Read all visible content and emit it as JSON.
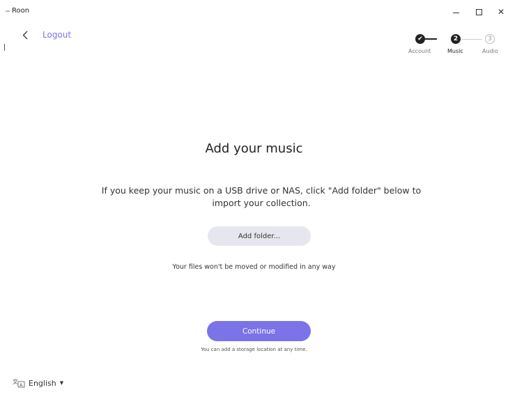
{
  "window": {
    "title": "Roon",
    "minimize_glyph": "–",
    "maximize_glyph": "☐",
    "close_glyph": "✕"
  },
  "nav": {
    "back_icon": "chevron-left-icon",
    "logout_label": "Logout"
  },
  "stepper": {
    "steps": [
      {
        "label": "Account",
        "marker": "✔",
        "state": "done"
      },
      {
        "label": "Music",
        "marker": "2",
        "state": "current"
      },
      {
        "label": "Audio",
        "marker": "3",
        "state": "upcoming"
      }
    ]
  },
  "main": {
    "heading": "Add your music",
    "description": "If you keep your music on a USB drive or NAS, click \"Add folder\" below to import your collection.",
    "add_folder_label": "Add folder...",
    "files_note": "Your files won't be moved or modified in any way",
    "continue_label": "Continue",
    "storage_note": "You can add a storage location at any time."
  },
  "footer": {
    "language_label": "English",
    "language_icon": "translate-icon",
    "caret": "▼"
  },
  "colors": {
    "accent": "#7a74e8",
    "secondary_button": "#e6e7ee",
    "step_active": "#222222"
  }
}
